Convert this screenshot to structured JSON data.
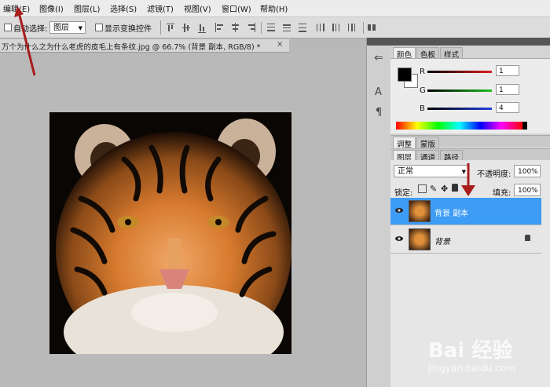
{
  "menubar": {
    "items": [
      "编辑(E)",
      "图像(I)",
      "图层(L)",
      "选择(S)",
      "滤镜(T)",
      "视图(V)",
      "窗口(W)",
      "帮助(H)"
    ]
  },
  "options": {
    "auto_select_label": "自动选择:",
    "auto_select_value": "图层",
    "show_transform_label": "显示变换控件"
  },
  "document": {
    "title": "万个为什么之为什么老虎的皮毛上有条纹.jpg @ 66.7% (背景 副本, RGB/8) *",
    "close_glyph": "×"
  },
  "color_panel": {
    "tabs": [
      "颜色",
      "色板",
      "样式"
    ],
    "channels": [
      {
        "label": "R",
        "value": "1",
        "color": "#e02020"
      },
      {
        "label": "G",
        "value": "1",
        "color": "#20c020"
      },
      {
        "label": "B",
        "value": "4",
        "color": "#2040e0"
      }
    ]
  },
  "adjust_panel": {
    "tabs": [
      "调整",
      "蒙版"
    ]
  },
  "layers_panel": {
    "tabs": [
      "图层",
      "通道",
      "路径"
    ],
    "blend_mode": "正常",
    "opacity_label": "不透明度:",
    "opacity_value": "100%",
    "lock_label": "锁定:",
    "fill_label": "填充:",
    "fill_value": "100%",
    "layers": [
      {
        "name": "背景 副本",
        "selected": true
      },
      {
        "name": "背景",
        "selected": false
      }
    ]
  },
  "watermark": {
    "brand": "Bai 经验",
    "url": "jingyan.baidu.com"
  },
  "accent": {
    "selected_layer": "#3d9cf5",
    "annotation_arrow": "#a81c1c"
  }
}
